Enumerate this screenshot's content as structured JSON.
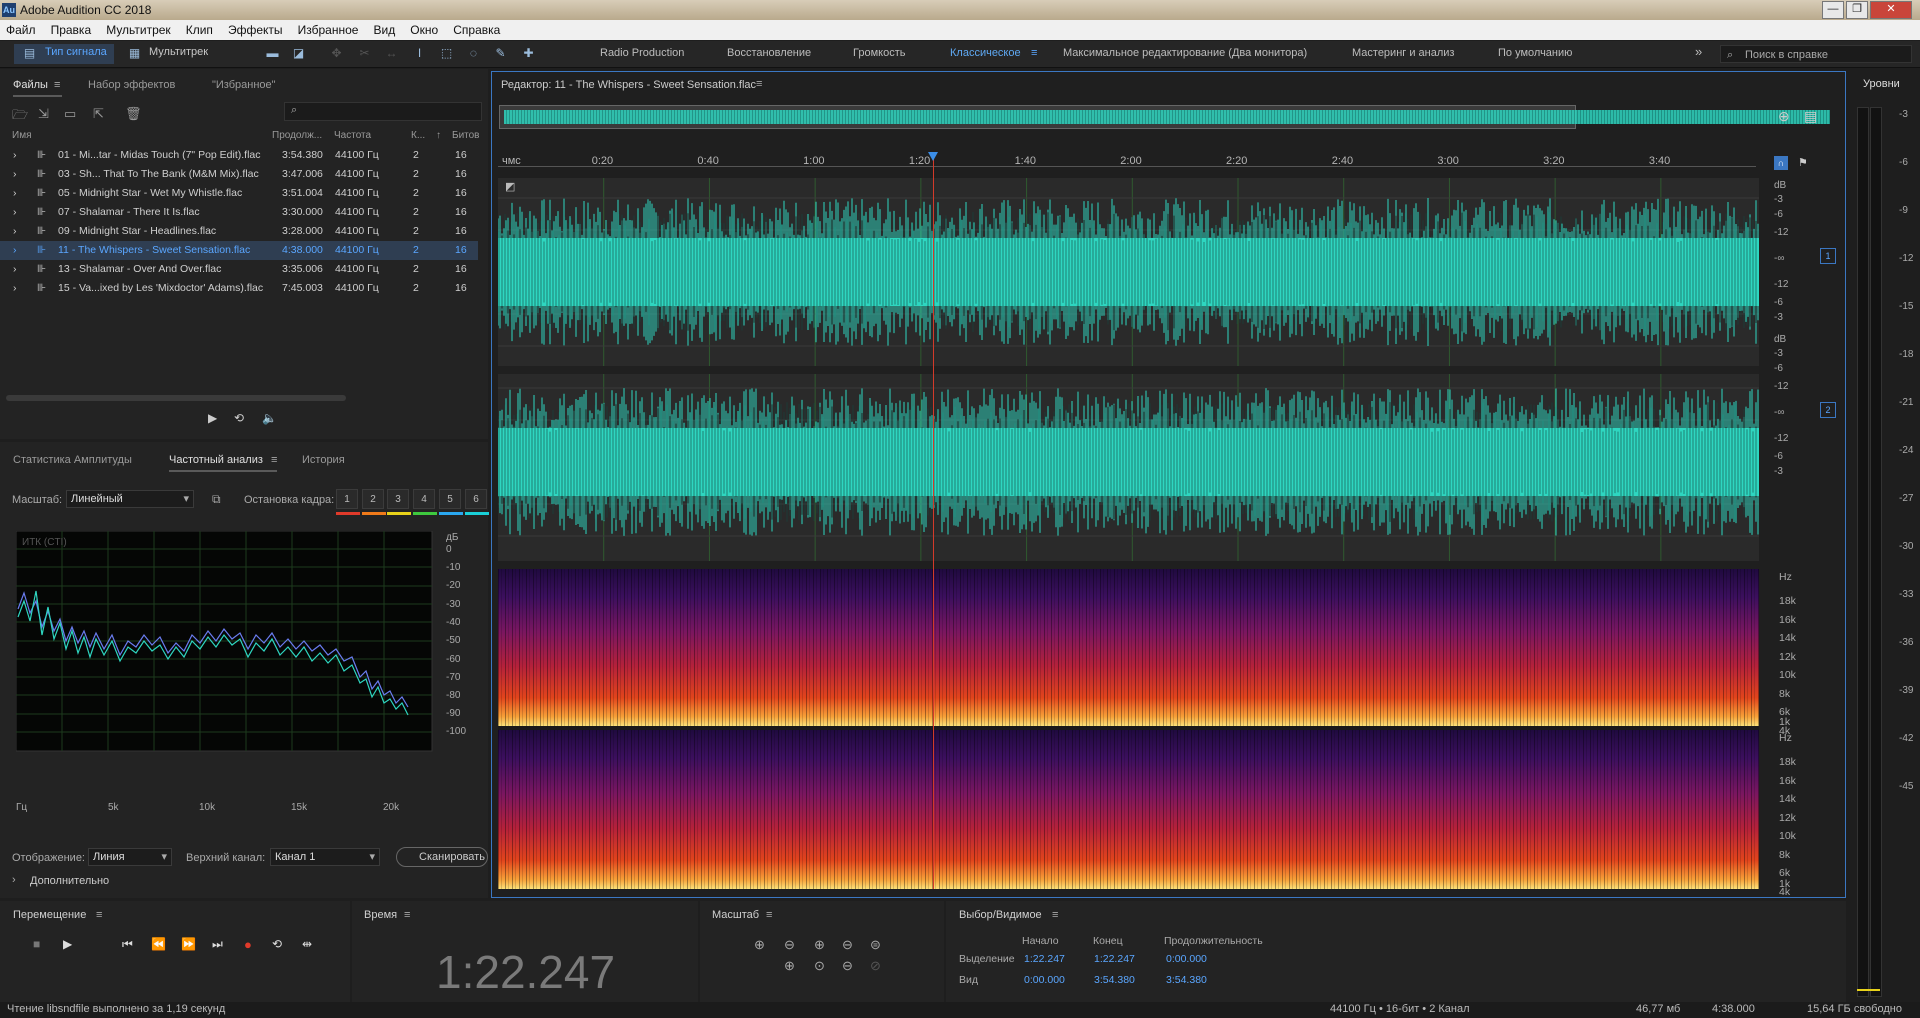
{
  "window": {
    "title": "Adobe Audition CC 2018",
    "app_icon": "Au",
    "controls": [
      "—",
      "❐",
      "✕"
    ]
  },
  "menu": [
    "Файл",
    "Правка",
    "Мультитрек",
    "Клип",
    "Эффекты",
    "Избранное",
    "Вид",
    "Окно",
    "Справка"
  ],
  "toolbar": {
    "waveform_label": "Тип сигнала",
    "multitrack_label": "Мультитрек",
    "workspaces": [
      "Radio Production",
      "Восстановление",
      "Громкость",
      "Классическое",
      "Максимальное редактирование (Два монитора)",
      "Мастеринг и анализ",
      "По умолчанию"
    ],
    "active_workspace": "Классическое",
    "overflow": "»",
    "help_placeholder": "Поиск в справке"
  },
  "files_panel": {
    "tabs": [
      "Файлы",
      "Набор эффектов",
      "\"Избранное\""
    ],
    "columns": [
      "Имя",
      "Продолж...",
      "Частота",
      "К...",
      "Битов"
    ],
    "files": [
      {
        "name": "01 - Mi...tar - Midas Touch (7\" Pop Edit).flac",
        "duration": "3:54.380",
        "rate": "44100 Гц",
        "ch": "2",
        "bits": "16"
      },
      {
        "name": "03 - Sh... That To The Bank (M&M Mix).flac",
        "duration": "3:47.006",
        "rate": "44100 Гц",
        "ch": "2",
        "bits": "16"
      },
      {
        "name": "05 - Midnight Star - Wet My Whistle.flac",
        "duration": "3:51.004",
        "rate": "44100 Гц",
        "ch": "2",
        "bits": "16"
      },
      {
        "name": "07 - Shalamar - There It Is.flac",
        "duration": "3:30.000",
        "rate": "44100 Гц",
        "ch": "2",
        "bits": "16"
      },
      {
        "name": "09 - Midnight Star - Headlines.flac",
        "duration": "3:28.000",
        "rate": "44100 Гц",
        "ch": "2",
        "bits": "16"
      },
      {
        "name": "11 - The Whispers - Sweet Sensation.flac",
        "duration": "4:38.000",
        "rate": "44100 Гц",
        "ch": "2",
        "bits": "16",
        "selected": true
      },
      {
        "name": "13 - Shalamar - Over And Over.flac",
        "duration": "3:35.006",
        "rate": "44100 Гц",
        "ch": "2",
        "bits": "16"
      },
      {
        "name": "15 - Va...ixed by Les 'Mixdoctor' Adams).flac",
        "duration": "7:45.003",
        "rate": "44100 Гц",
        "ch": "2",
        "bits": "16"
      }
    ]
  },
  "analysis_panel": {
    "tabs": [
      "Статистика Амплитуды",
      "Частотный анализ",
      "История"
    ],
    "scale_label": "Масштаб:",
    "scale_value": "Линейный",
    "freeze_label": "Остановка кадра:",
    "freeze_buttons": [
      "1",
      "2",
      "3",
      "4",
      "5",
      "6"
    ],
    "freeze_colors": [
      "#e03a2a",
      "#f07a1a",
      "#e8d21a",
      "#3ec93e",
      "#2aa8f0",
      "#1ad0d8"
    ],
    "graph_label": "ИТК (CTI)",
    "db_ticks": [
      "дБ",
      "0",
      "-10",
      "-20",
      "-30",
      "-40",
      "-50",
      "-60",
      "-70",
      "-80",
      "-90",
      "-100"
    ],
    "hz_ticks": [
      "Гц",
      "5k",
      "10k",
      "15k",
      "20k"
    ],
    "display_label": "Отображение:",
    "display_value": "Линия",
    "channel_label": "Верхний канал:",
    "channel_value": "Канал 1",
    "scan_button": "Сканировать",
    "advanced": "Дополнительно"
  },
  "editor": {
    "title": "Редактор: 11 - The Whispers - Sweet Sensation.flac",
    "time_unit": "чмс",
    "ticks": [
      "0:20",
      "0:40",
      "1:00",
      "1:20",
      "1:40",
      "2:00",
      "2:20",
      "2:40",
      "3:00",
      "3:20",
      "3:40"
    ],
    "playhead_seconds": 82.247,
    "timeline_max_seconds": 238,
    "db_labels": [
      "dB",
      "-3",
      "-6",
      "-12",
      "-∞",
      "-12",
      "-6",
      "-3"
    ],
    "channels": [
      "1",
      "2"
    ],
    "hz_labels": [
      "Hz",
      "18k",
      "16k",
      "14k",
      "12k",
      "10k",
      "8k",
      "6k",
      "4k",
      "1k"
    ],
    "waveform_color": "#2ed6c0",
    "playhead_color": "#d23a2a"
  },
  "transport": {
    "title": "Перемещение",
    "buttons": [
      "stop-icon",
      "play-icon",
      "go-start-icon",
      "rewind-icon",
      "forward-icon",
      "go-end-icon",
      "record-icon",
      "loop-icon",
      "skip-icon"
    ]
  },
  "time_panel": {
    "title": "Время",
    "value": "1:22.247"
  },
  "zoom_panel": {
    "title": "Масштаб"
  },
  "selection_panel": {
    "title": "Выбор/Видимое",
    "col_start": "Начало",
    "col_end": "Конец",
    "col_dur": "Продолжительность",
    "row_sel": "Выделение",
    "row_view": "Вид",
    "sel_start": "1:22.247",
    "sel_end": "1:22.247",
    "sel_dur": "0:00.000",
    "view_start": "0:00.000",
    "view_end": "3:54.380",
    "view_dur": "3:54.380"
  },
  "meter": {
    "title": "Уровни",
    "ticks": [
      "-3",
      "-6",
      "-9",
      "-12",
      "-15",
      "-18",
      "-21",
      "-24",
      "-27",
      "-30",
      "-33",
      "-36",
      "-39",
      "-42",
      "-45"
    ]
  },
  "status": {
    "left": "Чтение libsndfile выполнено за 1,19 секунд",
    "format": "44100 Гц • 16-бит • 2 Канал",
    "size": "46,77 мб",
    "duration": "4:38.000",
    "free": "15,64 ГБ свободно"
  }
}
